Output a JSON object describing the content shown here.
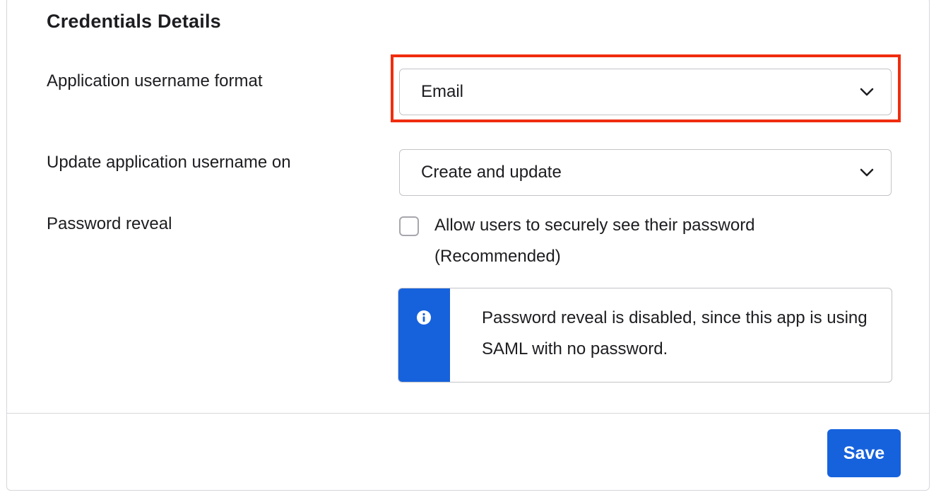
{
  "section": {
    "title": "Credentials Details"
  },
  "fields": {
    "username_format": {
      "label": "Application username format",
      "value": "Email"
    },
    "update_on": {
      "label": "Update application username on",
      "value": "Create and update"
    },
    "password_reveal": {
      "label": "Password reveal",
      "checkbox_label": "Allow users to securely see their password (Recommended)",
      "checked": false
    }
  },
  "info": {
    "message": "Password reveal is disabled, since this app is using SAML with no password.",
    "icon": "info-icon"
  },
  "actions": {
    "save_label": "Save"
  },
  "colors": {
    "primary": "#1662dd",
    "highlight": "#f02d0f"
  }
}
